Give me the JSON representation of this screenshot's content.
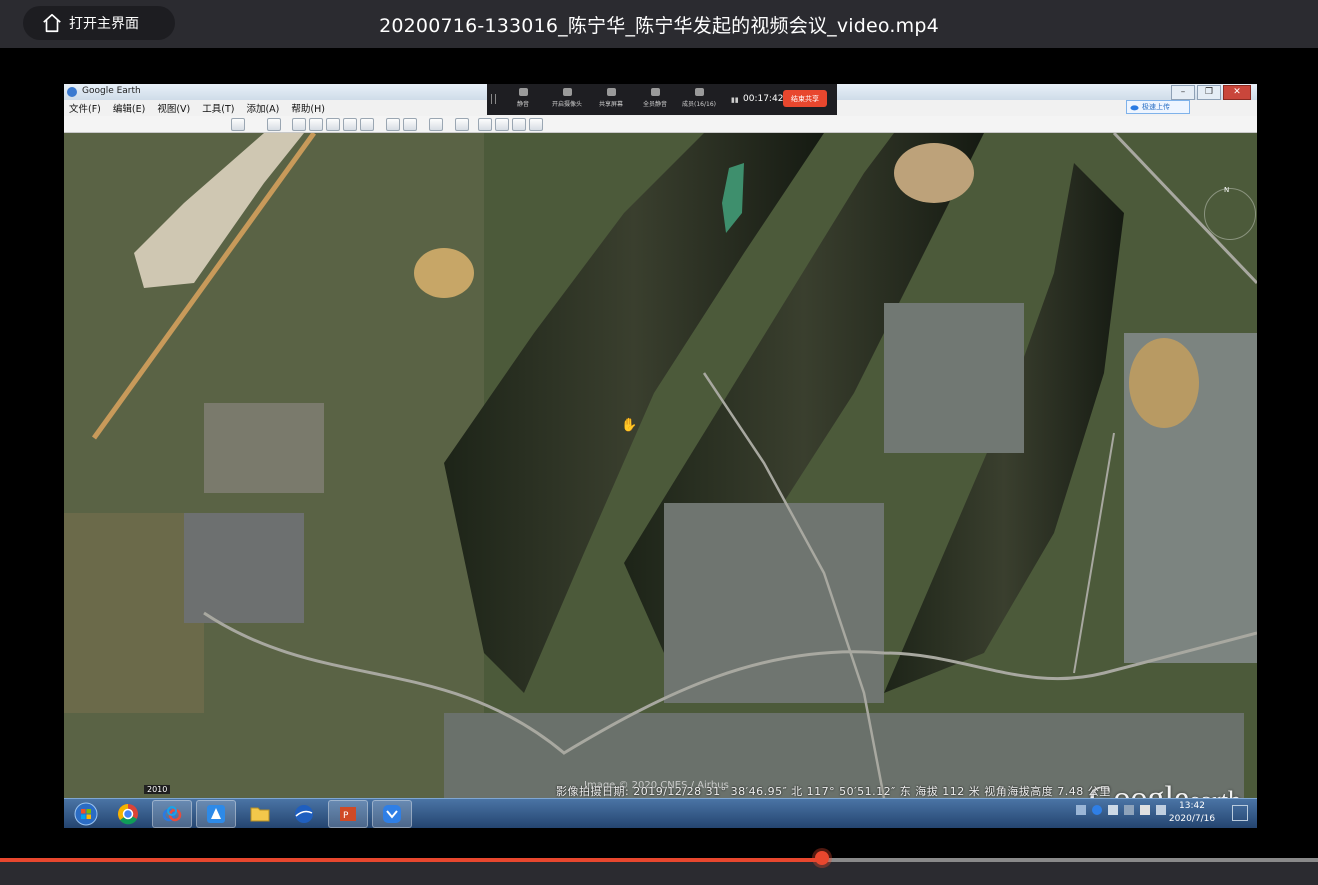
{
  "player": {
    "home_label": "打开主界面",
    "title": "20200716-133016_陈宁华_陈宁华发起的视频会议_video.mp4",
    "progress_fraction": 0.624,
    "accent_color": "#e8472e"
  },
  "google_earth": {
    "app_name": "Google Earth",
    "menus": [
      "文件(F)",
      "编辑(E)",
      "视图(V)",
      "工具(T)",
      "添加(A)",
      "帮助(H)"
    ],
    "baidu_upload": "极速上传",
    "image_credit": "Image © 2020 CNES / Airbus",
    "logo_main": "Google",
    "logo_sub": "earth",
    "imagery_year": "2010",
    "status_info": "影像拍摄日期: 2019/12/28   31° 38′46.95″ 北 117° 50′51.12″ 东 海拔   112 米   视角海拔高度   7.48 公里",
    "north_label": "N"
  },
  "meeting_toolbar": {
    "items": [
      "静音",
      "开启摄像头",
      "共享屏幕",
      "全员静音",
      "成员(16/16)"
    ],
    "timer": "00:17:42",
    "stop_share": "结束共享"
  },
  "taskbar": {
    "time": "13:42",
    "date": "2020/7/16",
    "apps": [
      "start-orb",
      "chrome",
      "baidu-netdisk",
      "explorer-app",
      "file-explorer",
      "google-earth",
      "powerpoint",
      "tencent-meeting"
    ]
  }
}
